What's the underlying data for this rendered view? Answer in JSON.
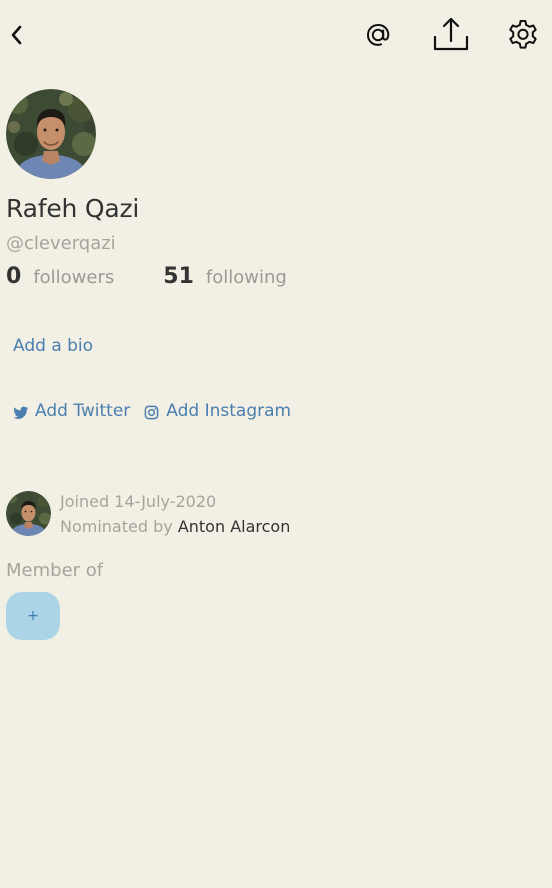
{
  "header": {
    "back_icon": "chevron-left-icon",
    "mention_icon": "at-sign-icon",
    "share_icon": "share-upload-icon",
    "settings_icon": "gear-icon"
  },
  "profile": {
    "name": "Rafeh Qazi",
    "handle": "@cleverqazi",
    "followers_count": "0",
    "followers_label": "followers",
    "following_count": "51",
    "following_label": "following",
    "add_bio": "Add a bio",
    "add_twitter": "Add Twitter",
    "add_instagram": "Add Instagram"
  },
  "joined": {
    "joined_text": "Joined 14-July-2020",
    "nominated_prefix": "Nominated by",
    "nominator": "Anton Alarcon"
  },
  "membership": {
    "label": "Member of",
    "add_label": "+"
  },
  "colors": {
    "background": "#f2efe4",
    "link": "#4a7fb0",
    "muted": "#a7a49c",
    "club_button": "#abd5e6"
  }
}
